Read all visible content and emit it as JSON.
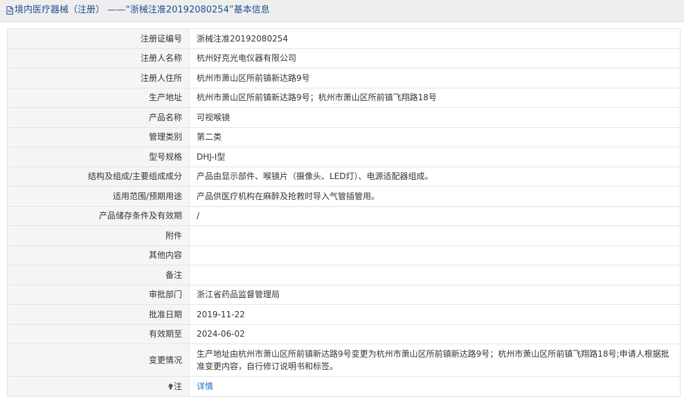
{
  "header": {
    "title": "境内医疗器械（注册） ——“浙械注准20192080254”基本信息",
    "icon": "document-icon"
  },
  "rows": [
    {
      "label": "注册证编号",
      "value": "浙械注准20192080254"
    },
    {
      "label": "注册人名称",
      "value": "杭州好克光电仪器有限公司"
    },
    {
      "label": "注册人住所",
      "value": "杭州市萧山区所前镇新达路9号"
    },
    {
      "label": "生产地址",
      "value": "杭州市萧山区所前镇新达路9号；杭州市萧山区所前镇飞翔路18号"
    },
    {
      "label": "产品名称",
      "value": "可视喉镜"
    },
    {
      "label": "管理类别",
      "value": "第二类"
    },
    {
      "label": "型号规格",
      "value": "DHJ-Ⅰ型"
    },
    {
      "label": "结构及组成/主要组成成分",
      "value": "产品由显示部件、喉镜片（摄像头、LED灯）、电源适配器组成。"
    },
    {
      "label": "适用范围/预期用途",
      "value": "产品供医疗机构在麻醉及抢救时导入气管插管用。"
    },
    {
      "label": "产品储存条件及有效期",
      "value": "/"
    },
    {
      "label": "附件",
      "value": ""
    },
    {
      "label": "其他内容",
      "value": ""
    },
    {
      "label": "备注",
      "value": ""
    },
    {
      "label": "审批部门",
      "value": "浙江省药品监督管理局"
    },
    {
      "label": "批准日期",
      "value": "2019-11-22"
    },
    {
      "label": "有效期至",
      "value": "2024-06-02"
    },
    {
      "label": "变更情况",
      "value": "生产地址由杭州市萧山区所前镇新达路9号变更为杭州市萧山区所前镇新达路9号；杭州市萧山区所前镇飞翔路18号;申请人根据批准变更内容，自行修订说明书和标签。"
    }
  ],
  "note": {
    "label": "注",
    "icon": "lightbulb-icon",
    "link_text": "详情"
  },
  "colors": {
    "title_text": "#1f4e8f",
    "link": "#1b6fc9",
    "label_bg": "#f5f5f5",
    "border": "#e5e5e5"
  }
}
